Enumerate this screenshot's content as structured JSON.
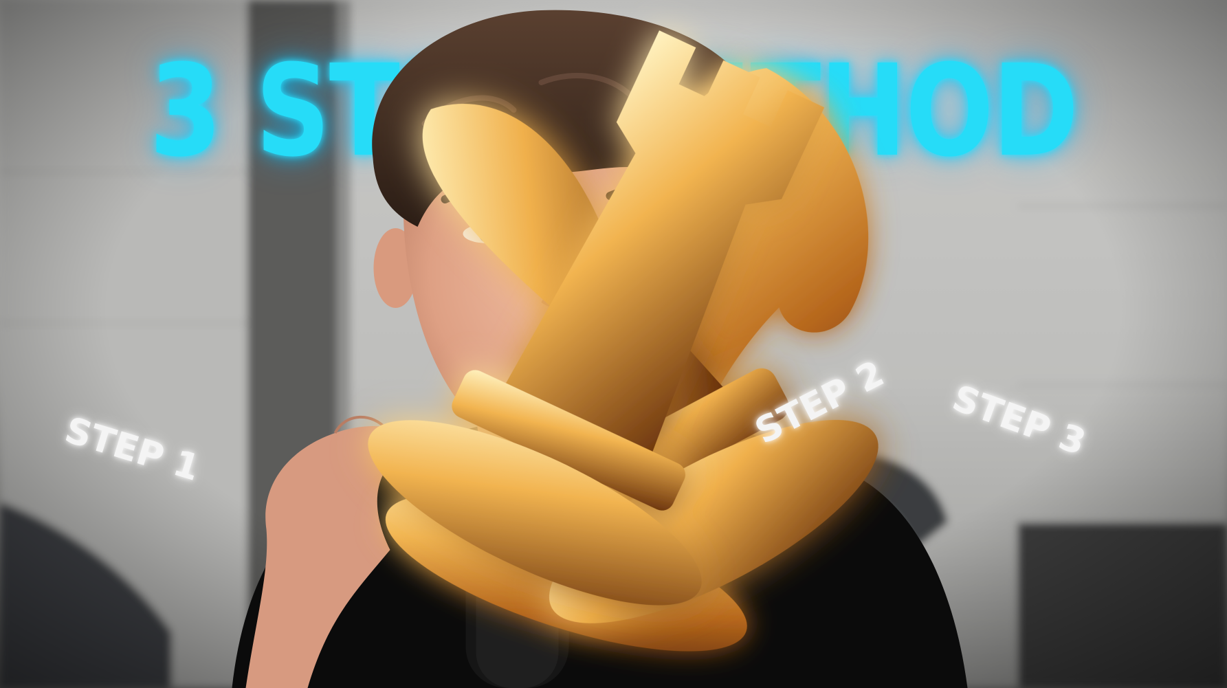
{
  "headline": "3 STEP METHOD",
  "steps": [
    "STEP 1",
    "STEP 2",
    "STEP 3"
  ],
  "colors": {
    "headline": "#26dcf8",
    "step_label": "#f4f4f4",
    "chess_gold": "#e0a040",
    "shirt": "#0b0b0b"
  },
  "icons": [
    "chess-knight-icon",
    "chess-bishop-icon",
    "chess-rook-icon",
    "microphone-icon"
  ]
}
